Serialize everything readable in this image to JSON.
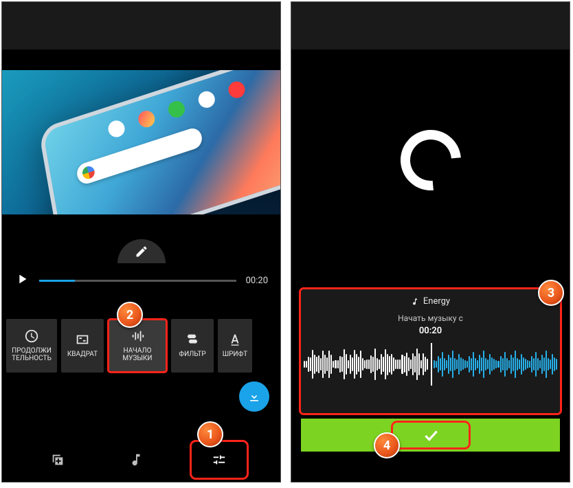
{
  "left": {
    "playback": {
      "timecode": "00:20"
    },
    "tools": {
      "duration": "ПРОДОЛЖИ\nТЕЛЬНОСТЬ",
      "square": "КВАДРАТ",
      "music_start": "НАЧАЛО\nМУЗЫКИ",
      "filter": "ФИЛЬТР",
      "font": "ШРИФТ"
    }
  },
  "right": {
    "track": {
      "title": "Energy",
      "caption": "Начать музыку с",
      "time": "00:20"
    }
  },
  "callouts": {
    "one": "1",
    "two": "2",
    "three": "3",
    "four": "4"
  }
}
